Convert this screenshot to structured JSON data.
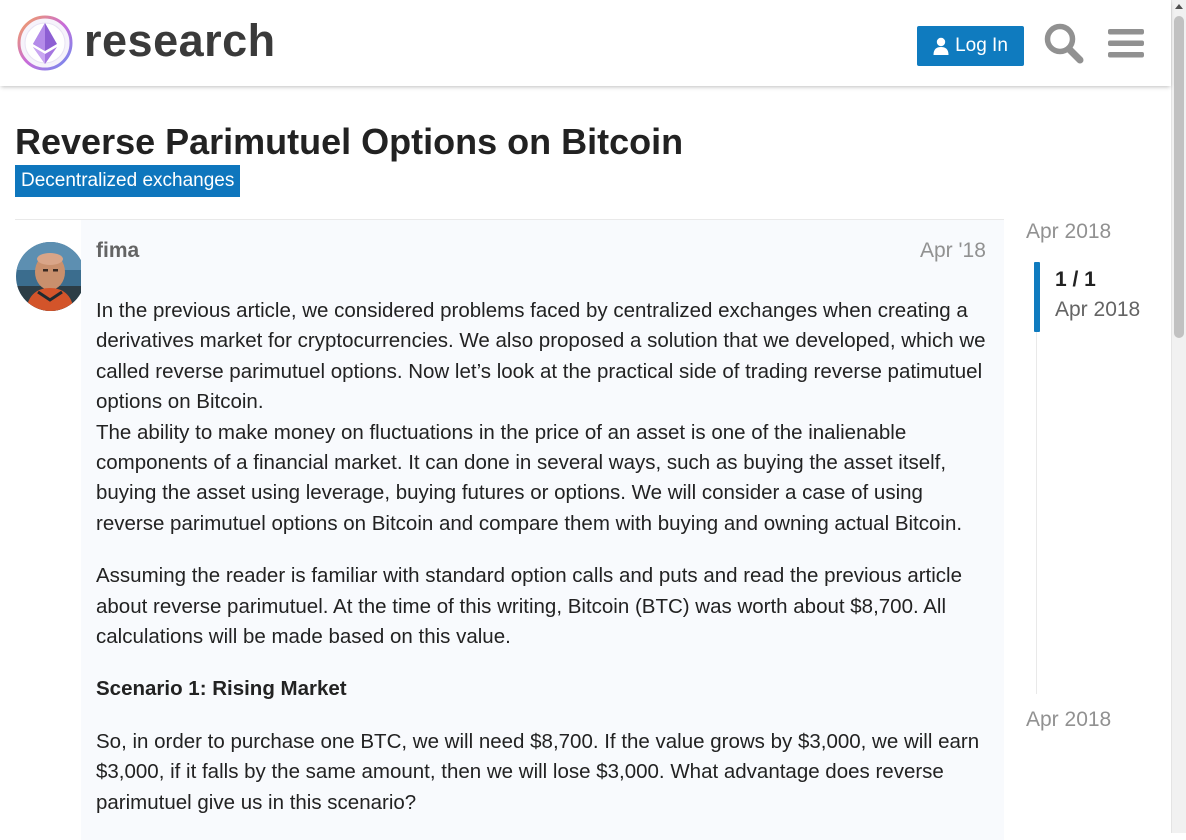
{
  "header": {
    "site_name": "research",
    "login_label": "Log In",
    "icons": {
      "logo": "ethereum-research-logo",
      "login": "user-icon",
      "search": "search-icon",
      "menu": "hamburger-menu-icon"
    },
    "colors": {
      "primary": "#0f7bbf",
      "logo_text": "#3a3a3a"
    }
  },
  "topic": {
    "title": "Reverse Parimutuel Options on Bitcoin",
    "category": "Decentralized exchanges",
    "category_color": "#0e76bd"
  },
  "post": {
    "username": "fima",
    "date": "Apr '18",
    "paragraphs": [
      "In the previous article, we considered problems faced by centralized exchanges when creating a derivatives market for cryptocurrencies. We also proposed a solution that we developed, which we called reverse parimutuel options. Now let’s look at the practical side of trading reverse patimutuel options on Bitcoin.",
      "The ability to make money on fluctuations in the price of an asset is one of the inalienable components of a financial market. It can done in several ways, such as buying the asset itself, buying the asset using leverage, buying futures or options. We will consider a case of using reverse parimutuel options on Bitcoin and compare them with buying and owning actual Bitcoin.",
      "Assuming the reader is familiar with standard option calls and puts and read the previous article about reverse parimutuel. At the time of this writing, Bitcoin (BTC) was worth about $8,700. All calculations will be made based on this value.",
      "Scenario 1: Rising Market",
      "So, in order to purchase one BTC, we will need $8,700. If the value grows by $3,000, we will earn $3,000, if it falls by the same amount, then we will lose $3,000. What advantage does reverse parimutuel give us in this scenario?"
    ]
  },
  "timeline": {
    "start_date": "Apr 2018",
    "position": "1 / 1",
    "current_date": "Apr 2018",
    "end_date": "Apr 2018"
  }
}
